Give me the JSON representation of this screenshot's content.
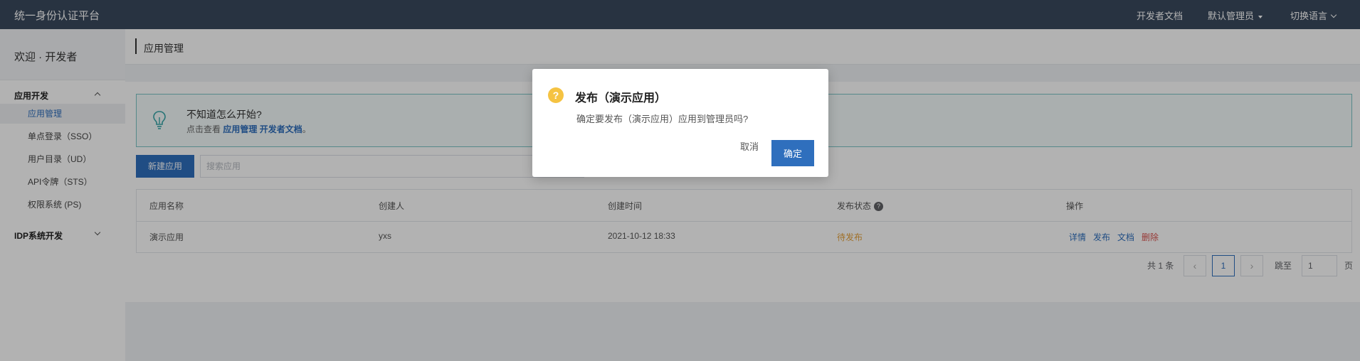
{
  "topbar": {
    "brand": "统一身份认证平台",
    "dev_docs": "开发者文档",
    "admin": "默认管理员",
    "language": "切换语言"
  },
  "sidebar": {
    "welcome": "欢迎 · 开发者",
    "group1": "应用开发",
    "items": [
      {
        "label": "应用管理"
      },
      {
        "label": "单点登录（SSO）"
      },
      {
        "label": "用户目录（UD）"
      },
      {
        "label": "API令牌（STS）"
      },
      {
        "label": "权限系统 (PS)"
      }
    ],
    "group2": "IDP系统开发"
  },
  "page": {
    "title": "应用管理"
  },
  "hint": {
    "title": "不知道怎么开始?",
    "prefix": "点击查看 ",
    "link1": "应用管理",
    "link2": "开发者文档",
    "suffix": "。"
  },
  "toolbar": {
    "new_app": "新建应用",
    "search_placeholder": "搜索应用"
  },
  "table": {
    "headers": [
      "应用名称",
      "创建人",
      "创建时间",
      "发布状态",
      "操作"
    ],
    "help_glyph": "?",
    "rows": [
      {
        "name": "演示应用",
        "creator": "yxs",
        "created": "2021-10-12 18:33",
        "status": "待发布",
        "status_color": "#e6a23c",
        "ops": [
          "详情",
          "发布",
          "文档",
          "删除"
        ]
      }
    ]
  },
  "pagination": {
    "total": "共 1 条",
    "prev": "‹",
    "current": "1",
    "next": "›",
    "jump_label": "跳至",
    "jump_value": "1",
    "page_unit": "页"
  },
  "modal": {
    "icon": "?",
    "title": "发布（演示应用）",
    "body": "确定要发布（演示应用）应用到管理员吗?",
    "cancel": "取消",
    "ok": "确定"
  },
  "colors": {
    "topbar": "#3a4a5e",
    "primary": "#2f6fbd",
    "warning": "#e6a23c",
    "danger": "#d9534f"
  }
}
